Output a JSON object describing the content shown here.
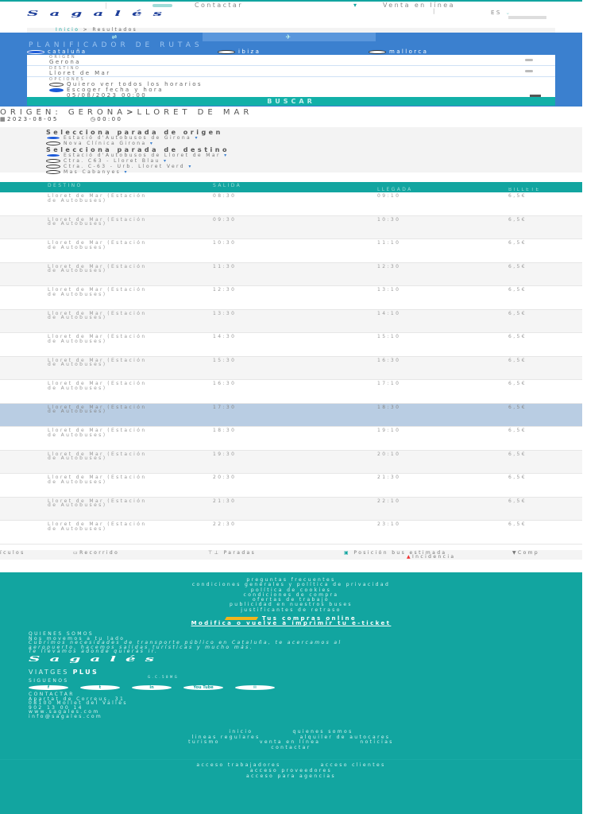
{
  "topbar": {
    "contact": "Contactar",
    "sale": "Venta en línea",
    "lang": "ES"
  },
  "brand": "Sagalés",
  "breadcrumb": {
    "home": "Inicio",
    "sep": ">",
    "current": "Resultados"
  },
  "planner": {
    "title": "PLANIFICADOR DE RUTAS",
    "regions": [
      "cataluña",
      "ibiza",
      "mallorca"
    ],
    "selected_region": "cataluña",
    "origin_label": "ORIGEN",
    "origin_value": "Gerona",
    "dest_label": "DESTINO",
    "dest_value": "Lloret de Mar",
    "options_label": "OPCIONES",
    "opt_all": "Quiero ver todos los horarios",
    "opt_date": "Escoger fecha y hora",
    "datetime": "05/08/2023 00:00",
    "search": "BUSCAR"
  },
  "route": {
    "title": "ORIGEN: GERONA",
    "arrow": ">",
    "dest": "LLORET DE MAR",
    "date": "2023-08-05",
    "time": "00:00"
  },
  "stops": {
    "origin_title": "Selecciona parada de origen",
    "origin": [
      "Estació d'Autobusos de Girona",
      "Nova Clínica Girona"
    ],
    "dest_title": "Selecciona parada de destino",
    "dest": [
      "Estació d'Autobusos de Lloret de Mar",
      "Ctra. C63 - Lloret Blau",
      "Ctra. C-63 - Urb. Lloret Verd",
      "Mas Cabanyes"
    ]
  },
  "table": {
    "headers": [
      "DESTINO",
      "SALIDA",
      "LLEGADA",
      "BILLETE"
    ],
    "rows": [
      [
        "Lloret de Mar (Estación de Autobuses)",
        "08:30",
        "09:10",
        "6,5€"
      ],
      [
        "Lloret de Mar (Estación de Autobuses)",
        "09:30",
        "10:30",
        "6,5€"
      ],
      [
        "Lloret de Mar (Estación de Autobuses)",
        "10:30",
        "11:10",
        "6,5€"
      ],
      [
        "Lloret de Mar (Estación de Autobuses)",
        "11:30",
        "12:30",
        "6,5€"
      ],
      [
        "Lloret de Mar (Estación de Autobuses)",
        "12:30",
        "13:10",
        "6,5€"
      ],
      [
        "Lloret de Mar (Estación de Autobuses)",
        "13:30",
        "14:10",
        "6,5€"
      ],
      [
        "Lloret de Mar (Estación de Autobuses)",
        "14:30",
        "15:10",
        "6,5€"
      ],
      [
        "Lloret de Mar (Estación de Autobuses)",
        "15:30",
        "16:30",
        "6,5€"
      ],
      [
        "Lloret de Mar (Estación de Autobuses)",
        "16:30",
        "17:10",
        "6,5€"
      ],
      [
        "Lloret de Mar (Estación de Autobuses)",
        "17:30",
        "18:30",
        "6,5€"
      ],
      [
        "Lloret de Mar (Estación de Autobuses)",
        "18:30",
        "19:10",
        "6,5€"
      ],
      [
        "Lloret de Mar (Estación de Autobuses)",
        "19:30",
        "20:10",
        "6,5€"
      ],
      [
        "Lloret de Mar (Estación de Autobuses)",
        "20:30",
        "21:30",
        "6,5€"
      ],
      [
        "Lloret de Mar (Estación de Autobuses)",
        "21:30",
        "22:10",
        "6,5€"
      ],
      [
        "Lloret de Mar (Estación de Autobuses)",
        "22:30",
        "23:10",
        "6,5€"
      ]
    ],
    "selected_index": 9
  },
  "legend": {
    "horarios": "ículos",
    "recorrido": "Recorrido",
    "paradas": "Paradas",
    "posicion": "Posición bus estimada",
    "incidencia": "Incidencia",
    "comprar": "Comp"
  },
  "footer": {
    "links": [
      "preguntas frecuentes",
      "condiciones generales y política de privacidad",
      "política de cookies",
      "condiciones de compra",
      "ofertas de trabajo",
      "publicidad en nuestros buses",
      "justificantes de retraso"
    ],
    "promo_title": "Tus compras online",
    "promo_link": "Modifica o vuelve a imprimir tu e-ticket",
    "about_title": "QUIENES SOMOS",
    "about_lead": "Nos movemos a tu lado",
    "about_text": "Cubrimos necesidades de transporte público en Cataluña, te acercamos al aeropuerto, hacemos salidas turísticas y mucho más.",
    "about_tail": "Te llevamos adonde quieras ir.",
    "viatges": "VIATGES",
    "plus": "PLUS",
    "plus_code": "G.C.58MG",
    "follow": "SIGUENOS",
    "social": [
      "f",
      "t",
      "in",
      "You Tube",
      "✉"
    ],
    "contact_title": "CONTACTAR",
    "address": "Apartat de Correus, 31",
    "city": "08100 Mollet del Vallès",
    "phone": "902 13 00 14",
    "web": "www.sagales.com",
    "email": "info@sagales.com",
    "nav": [
      "inicio",
      "quienes somos",
      "lineas regulares",
      "alquiler de autocares",
      "turismo",
      "venta en línea",
      "noticias",
      "contactar"
    ],
    "access": [
      "acceso trabajadores",
      "acceso clientes",
      "acceso proveedores",
      "acceso para agencias"
    ]
  },
  "colors": {
    "teal": "#12a5a0",
    "blue": "#3b80cf",
    "selected_row": "#b9cde3"
  }
}
